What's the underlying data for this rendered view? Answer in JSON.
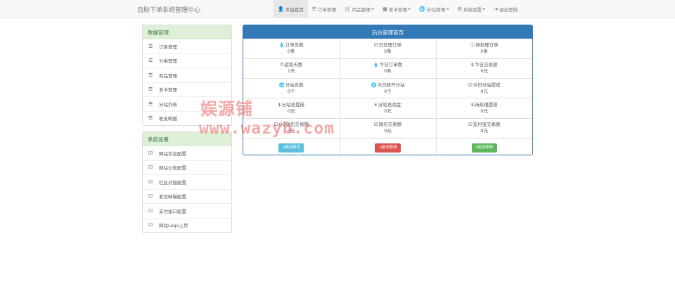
{
  "brand": "自助下单系统管理中心",
  "nav": [
    {
      "icon": "👤",
      "icon_name": "user-icon",
      "label": "平台首页",
      "active": true,
      "caret": false
    },
    {
      "icon": "☰",
      "icon_name": "list-icon",
      "label": "订单管理",
      "active": false,
      "caret": false
    },
    {
      "icon": "🛒",
      "icon_name": "cart-icon",
      "label": "商品管理",
      "active": false,
      "caret": true
    },
    {
      "icon": "▦",
      "icon_name": "grid-icon",
      "label": "发卡管理",
      "active": false,
      "caret": true
    },
    {
      "icon": "🌐",
      "icon_name": "globe-icon",
      "label": "分站管理",
      "active": false,
      "caret": true
    },
    {
      "icon": "⚙",
      "icon_name": "gear-icon",
      "label": "系统设置",
      "active": false,
      "caret": true
    },
    {
      "icon": "⇥",
      "icon_name": "logout-icon",
      "label": "退出登陆",
      "active": false,
      "caret": false
    }
  ],
  "sidebar_data": {
    "title": "数据管理",
    "items": [
      "订单管理",
      "分类管理",
      "商品管理",
      "发卡管理",
      "分站列表",
      "收支明细"
    ]
  },
  "sidebar_settings": {
    "title": "系统设置",
    "items": [
      "网站信息配置",
      "网站公告配置",
      "社区对接配置",
      "发信邮箱配置",
      "支付接口配置",
      "网站Logo上传"
    ]
  },
  "panel": {
    "title": "后台管理首页",
    "rows": [
      [
        {
          "icon": "💧",
          "icon_name": "drop-icon",
          "label": "订单总数",
          "value": "0条"
        },
        {
          "icon": "☑",
          "icon_name": "check-icon",
          "label": "已处理订单",
          "value": "0条"
        },
        {
          "icon": "ⓘ",
          "icon_name": "info-icon",
          "label": "待处理订单",
          "value": "0条"
        }
      ],
      [
        {
          "icon": "⏱",
          "icon_name": "clock-icon",
          "label": "运营天数",
          "value": "1天"
        },
        {
          "icon": "💧",
          "icon_name": "drop-icon",
          "label": "今日订单数",
          "value": "0条"
        },
        {
          "icon": "$",
          "icon_name": "dollar-icon",
          "label": "今日交易额",
          "value": "0元"
        }
      ],
      [
        {
          "icon": "🌐",
          "icon_name": "globe-icon",
          "label": "分站总数",
          "value": "0个"
        },
        {
          "icon": "🌐",
          "icon_name": "globe-icon",
          "label": "今日新开分站",
          "value": "0个"
        },
        {
          "icon": "☑",
          "icon_name": "check-icon",
          "label": "今日分站提成",
          "value": "0元"
        }
      ],
      [
        {
          "icon": "$",
          "icon_name": "dollar-icon",
          "label": "分站总提成",
          "value": "0元"
        },
        {
          "icon": "€",
          "icon_name": "euro-icon",
          "label": "分站总资金",
          "value": "0元"
        },
        {
          "icon": "$",
          "icon_name": "dollar-icon",
          "label": "待处理提现",
          "value": "0元"
        }
      ],
      [
        {
          "icon": "☑",
          "icon_name": "check-icon",
          "label": "QQ钱包交易额",
          "value": "0元"
        },
        {
          "icon": "☑",
          "icon_name": "check-icon",
          "label": "微信交易额",
          "value": "0元"
        },
        {
          "icon": "☑",
          "icon_name": "check-icon",
          "label": "支付宝交易额",
          "value": "0元"
        }
      ]
    ],
    "buttons": [
      {
        "icon": "⌂",
        "icon_name": "home-icon",
        "label": "网站首页",
        "style": "info"
      },
      {
        "icon": "⇥",
        "icon_name": "logout-icon",
        "label": "退出登录",
        "style": "danger"
      },
      {
        "icon": "⌂",
        "icon_name": "home-icon",
        "label": "检测更新",
        "style": "success"
      }
    ]
  },
  "watermark": {
    "line1": "娱源铺",
    "line2": "www.wazyb.com"
  }
}
